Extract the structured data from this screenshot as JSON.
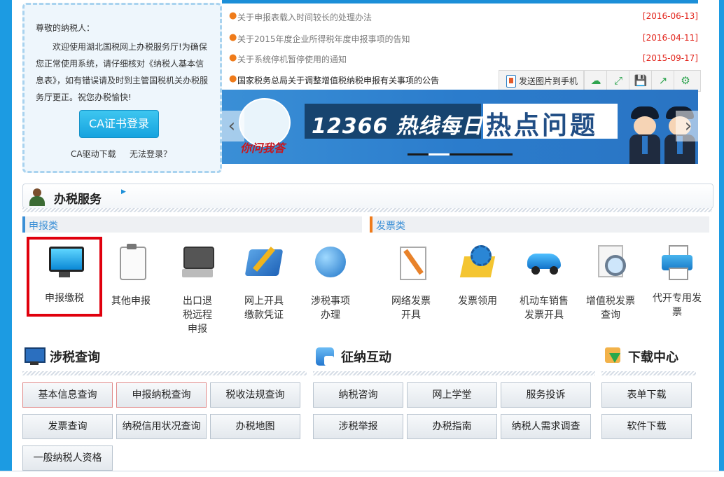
{
  "welcome": {
    "greeting": "尊敬的纳税人：",
    "body": "欢迎使用湖北国税网上办税服务厅!为确保您正常使用系统，请仔细核对《纳税人基本信息表》，如有错误请及时到主管国税机关办税服务厅更正。祝您办税愉快!",
    "ca_login_label": "CA证书登录",
    "ca_driver_link": "CA驱动下载",
    "cannot_login_link": "无法登录？"
  },
  "news": [
    {
      "title": "关于申报表载入时间较长的处理办法",
      "date": "[2016-06-13]"
    },
    {
      "title": "关于2015年度企业所得税年度申报事项的告知",
      "date": "[2016-04-11]"
    },
    {
      "title": "关于系统停机暂停使用的通知",
      "date": "[2015-09-17]"
    },
    {
      "title": "国家税务总局关于调整增值税纳税申报有关事项的公告",
      "date": ""
    }
  ],
  "share_bar": {
    "send_label": "发送图片到手机",
    "icons": [
      "cloud-icon",
      "expand-icon",
      "save-icon",
      "share-icon",
      "settings-icon"
    ],
    "icon_glyphs": [
      "☁",
      "⤢",
      "💾",
      "↗",
      "⚙"
    ]
  },
  "banner": {
    "hotline": "12366 热线每日",
    "hot": "热点问题",
    "logo_text": "你问我答"
  },
  "service": {
    "title": "办税服务",
    "category_filing": "申报类",
    "category_invoice": "发票类",
    "filing_items": [
      {
        "label": "申报缴税",
        "icon": "monitor-icon"
      },
      {
        "label": "其他申报",
        "icon": "clipboard-icon"
      },
      {
        "label": "出口退税远程申报",
        "icon": "computer-icon"
      },
      {
        "label": "网上开具缴款凭证",
        "icon": "folder-icon"
      },
      {
        "label": "涉税事项办理",
        "icon": "globe-icon"
      }
    ],
    "invoice_items": [
      {
        "label": "网络发票开具",
        "icon": "document-icon"
      },
      {
        "label": "发票领用",
        "icon": "gear-box-icon"
      },
      {
        "label": "机动车销售发票开具",
        "icon": "car-icon"
      },
      {
        "label": "增值税发票查询",
        "icon": "magnifier-icon"
      },
      {
        "label": "代开专用发票",
        "icon": "printer-icon"
      }
    ]
  },
  "query": {
    "title": "涉税查询",
    "buttons": [
      "基本信息查询",
      "申报纳税查询",
      "税收法规查询",
      "发票查询",
      "纳税信用状况查询",
      "办税地图",
      "一般纳税人资格"
    ]
  },
  "interaction": {
    "title": "征纳互动",
    "buttons": [
      "纳税咨询",
      "网上学堂",
      "服务投诉",
      "涉税举报",
      "办税指南",
      "纳税人需求调查"
    ]
  },
  "download": {
    "title": "下载中心",
    "buttons": [
      "表单下载",
      "软件下载"
    ]
  },
  "colors": {
    "page_bg": "#1c9be2",
    "accent_blue": "#1c8fd8",
    "date_red": "#e2231a",
    "bullet_orange": "#ef7b1a",
    "highlight_red": "#e0000d"
  }
}
